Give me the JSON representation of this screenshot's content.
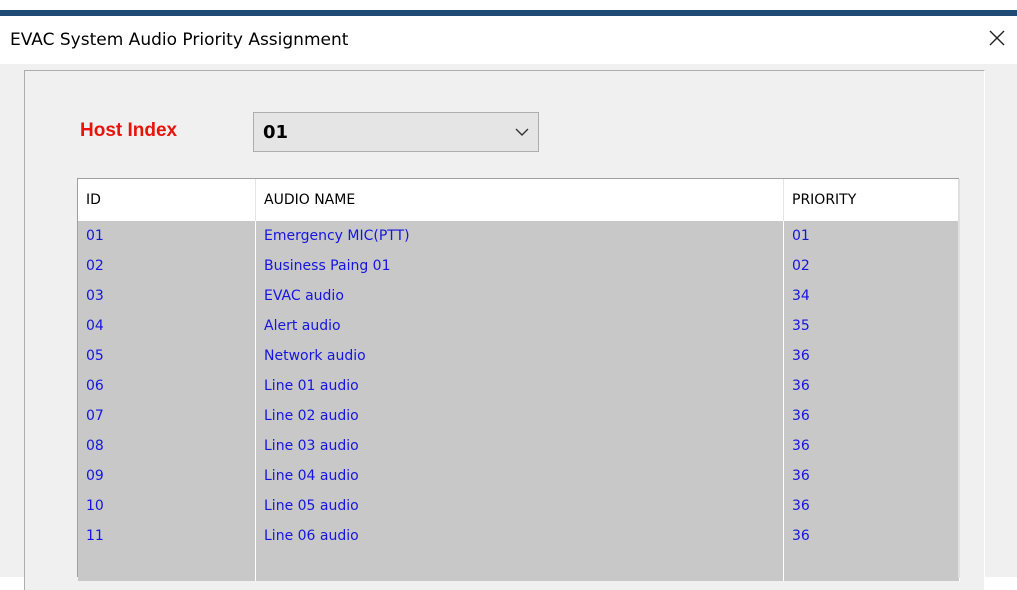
{
  "window": {
    "title": "EVAC System Audio Priority Assignment",
    "close_icon": "close-icon"
  },
  "host": {
    "label": "Host Index",
    "selected": "01",
    "label_color": "#e8140c"
  },
  "table": {
    "columns": [
      "ID",
      "AUDIO NAME",
      "PRIORITY"
    ],
    "row_text_color": "#1515e0",
    "rows": [
      {
        "id": "01",
        "name": "Emergency MIC(PTT)",
        "priority": "01"
      },
      {
        "id": "02",
        "name": "Business Paing 01",
        "priority": "02"
      },
      {
        "id": "03",
        "name": "EVAC audio",
        "priority": "34"
      },
      {
        "id": "04",
        "name": "Alert audio",
        "priority": "35"
      },
      {
        "id": "05",
        "name": "Network audio",
        "priority": "36"
      },
      {
        "id": "06",
        "name": "Line 01 audio",
        "priority": "36"
      },
      {
        "id": "07",
        "name": "Line 02 audio",
        "priority": "36"
      },
      {
        "id": "08",
        "name": "Line 03 audio",
        "priority": "36"
      },
      {
        "id": "09",
        "name": "Line 04 audio",
        "priority": "36"
      },
      {
        "id": "10",
        "name": "Line 05 audio",
        "priority": "36"
      },
      {
        "id": "11",
        "name": "Line 06 audio",
        "priority": "36"
      },
      {
        "id": "",
        "name": "",
        "priority": ""
      }
    ]
  }
}
